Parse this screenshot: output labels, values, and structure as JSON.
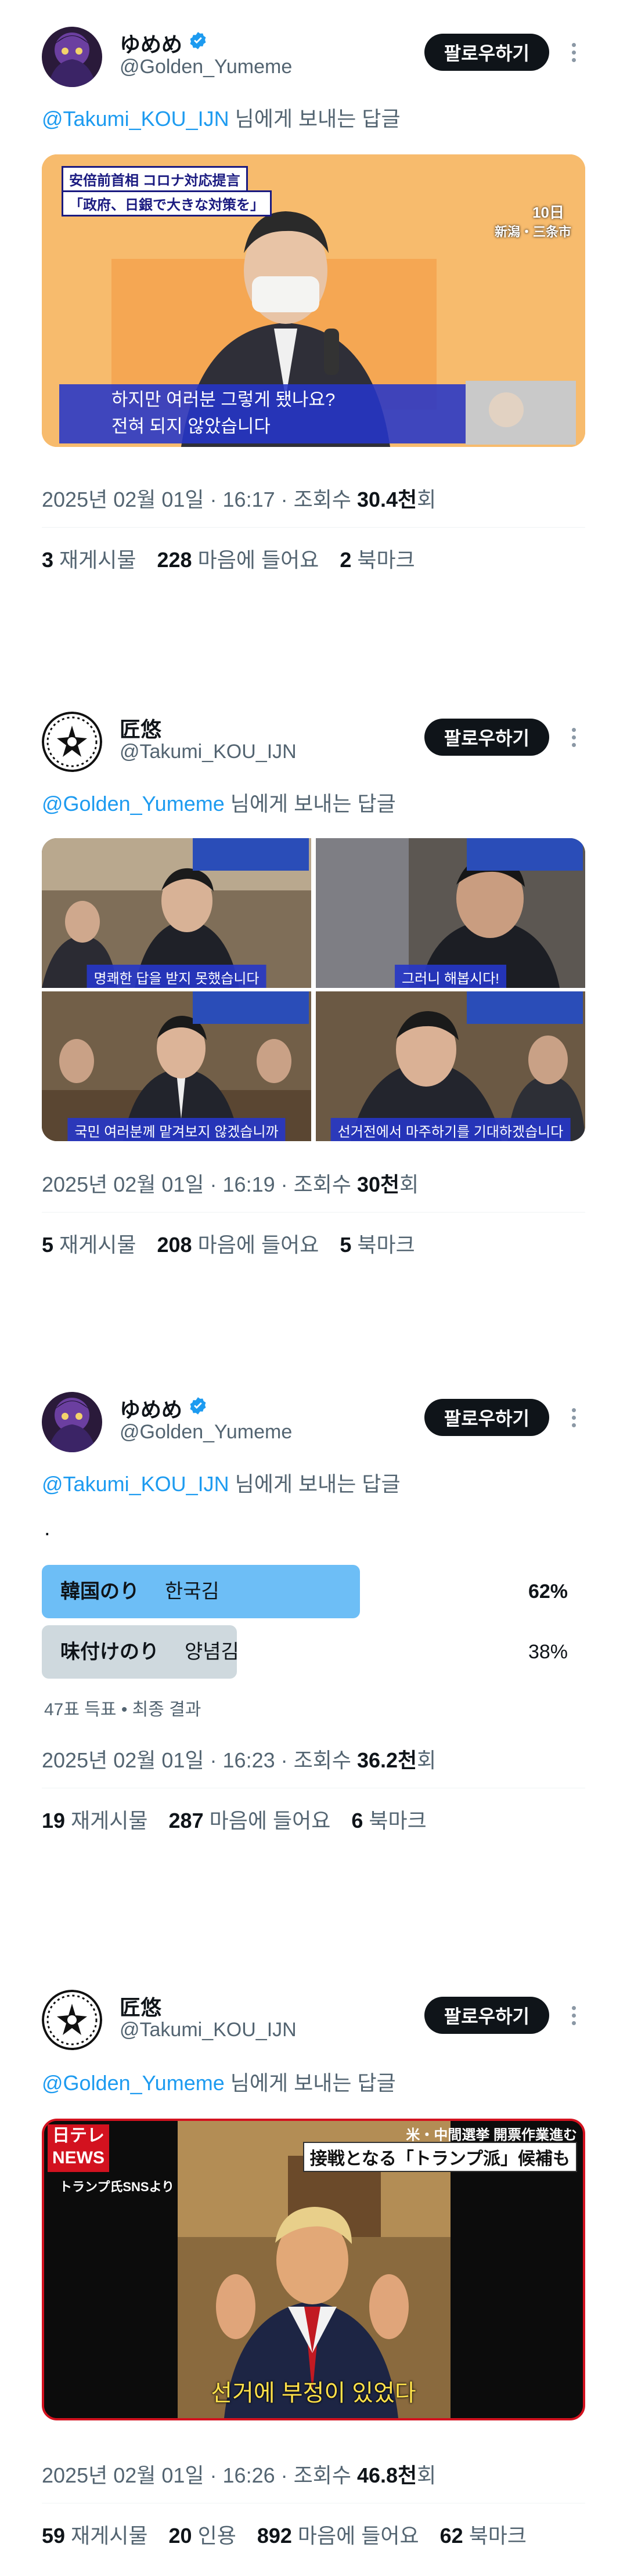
{
  "tweets": [
    {
      "name": "ゆめめ",
      "verified": true,
      "handle": "@Golden_Yumeme",
      "follow_label": "팔로우하기",
      "reply_to": "@Takumi_KOU_IJN",
      "reply_suffix": " 님에게 보내는 답글",
      "media": {
        "top_caption": "安倍前首相  コロナ対応提言",
        "top_caption2": "「政府、日銀で大きな対策を」",
        "date_label": "10日",
        "place_label": "新潟・三条市",
        "subtitle_line1": "하지만 여러분 그렇게 됐나요?",
        "subtitle_line2": "전혀 되지 않았습니다"
      },
      "time": "2025년 02월 01일 · 16:17 · 조회수 ",
      "views": "30.4천",
      "views_suffix": "회",
      "stats": [
        {
          "num": "3",
          "label": "재게시물"
        },
        {
          "num": "228",
          "label": "마음에 들어요"
        },
        {
          "num": "2",
          "label": "북마크"
        }
      ]
    },
    {
      "name": "匠悠",
      "verified": false,
      "handle": "@Takumi_KOU_IJN",
      "follow_label": "팔로우하기",
      "reply_to": "@Golden_Yumeme",
      "reply_suffix": " 님에게 보내는 답글",
      "media": {
        "cap1": "명쾌한 답을 받지 못했습니다",
        "cap2": "그러니 해봅시다!",
        "cap3": "국민 여러분께 맡겨보지 않겠습니까",
        "cap4": "선거전에서 마주하기를 기대하겠습니다"
      },
      "time": "2025년 02월 01일 · 16:19 · 조회수 ",
      "views": "30천",
      "views_suffix": "회",
      "stats": [
        {
          "num": "5",
          "label": "재게시물"
        },
        {
          "num": "208",
          "label": "마음에 들어요"
        },
        {
          "num": "5",
          "label": "북마크"
        }
      ]
    },
    {
      "name": "ゆめめ",
      "verified": true,
      "handle": "@Golden_Yumeme",
      "follow_label": "팔로우하기",
      "reply_to": "@Takumi_KOU_IJN",
      "reply_suffix": " 님에게 보내는 답글",
      "body": ".",
      "poll": {
        "options": [
          {
            "jp": "韓国のり",
            "kr": "한국김",
            "pct": "62%",
            "fraction": 0.62,
            "color": "#6dbef6"
          },
          {
            "jp": "味付けのり",
            "kr": "양념김",
            "pct": "38%",
            "fraction": 0.38,
            "color": "#cfd9de"
          }
        ],
        "summary": "47표 득표 • 최종 결과"
      },
      "time": "2025년 02월 01일 · 16:23 · 조회수 ",
      "views": "36.2천",
      "views_suffix": "회",
      "stats": [
        {
          "num": "19",
          "label": "재게시물"
        },
        {
          "num": "287",
          "label": "마음에 들어요"
        },
        {
          "num": "6",
          "label": "북마크"
        }
      ]
    },
    {
      "name": "匠悠",
      "verified": false,
      "handle": "@Takumi_KOU_IJN",
      "follow_label": "팔로우하기",
      "reply_to": "@Golden_Yumeme",
      "reply_suffix": " 님에게 보내는 답글",
      "media": {
        "logo_top": "日テレ",
        "logo_bottom": "NEWS",
        "source": "トランプ氏SNSより",
        "headline1": "米・中間選挙 開票作業進む",
        "headline2": "接戦となる「トランプ派」候補も",
        "subtitle": "선거에 부정이 있었다"
      },
      "time": "2025년 02월 01일 · 16:26 · 조회수 ",
      "views": "46.8천",
      "views_suffix": "회",
      "stats": [
        {
          "num": "59",
          "label": "재게시물"
        },
        {
          "num": "20",
          "label": "인용"
        },
        {
          "num": "892",
          "label": "마음에 들어요"
        },
        {
          "num": "62",
          "label": "북마크"
        }
      ]
    }
  ]
}
